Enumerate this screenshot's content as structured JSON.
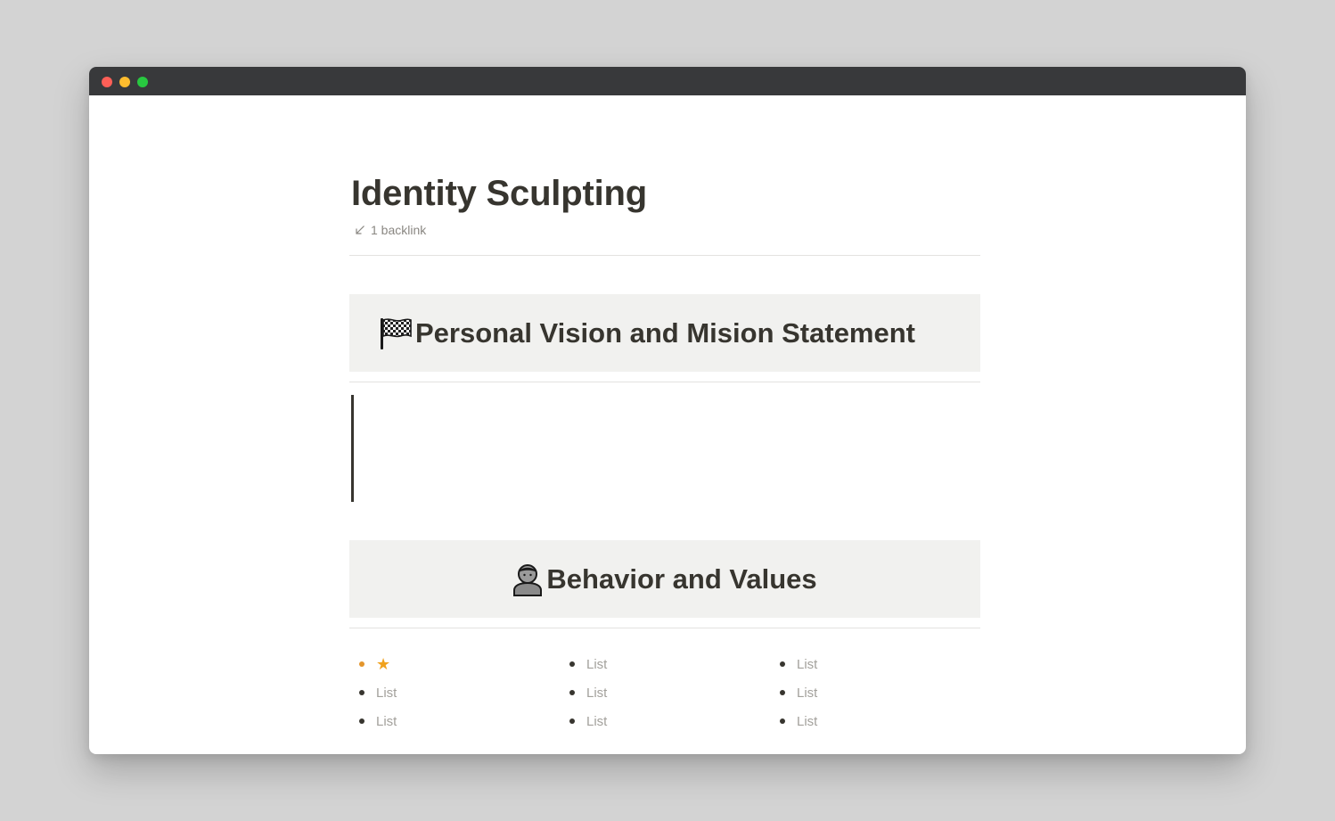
{
  "window": {
    "controls": {
      "close_color": "#fe5f57",
      "minimize_color": "#febc2e",
      "zoom_color": "#28c840"
    }
  },
  "page": {
    "title": "Identity Sculpting",
    "backlink": {
      "icon": "arrow-down-left-icon",
      "label": "1 backlink"
    }
  },
  "sections": [
    {
      "icon": "chequered-flag-icon",
      "heading": "Personal Vision and Mision Statement"
    },
    {
      "icon": "person-icon",
      "heading": "Behavior and Values"
    }
  ],
  "columns": [
    {
      "items": [
        {
          "text": "★",
          "icon": "star-icon",
          "color": "#f0a21e"
        },
        {
          "text": "List"
        },
        {
          "text": "List"
        }
      ]
    },
    {
      "items": [
        {
          "text": "List"
        },
        {
          "text": "List"
        },
        {
          "text": "List"
        }
      ]
    },
    {
      "items": [
        {
          "text": "List"
        },
        {
          "text": "List"
        },
        {
          "text": "List"
        }
      ]
    }
  ]
}
